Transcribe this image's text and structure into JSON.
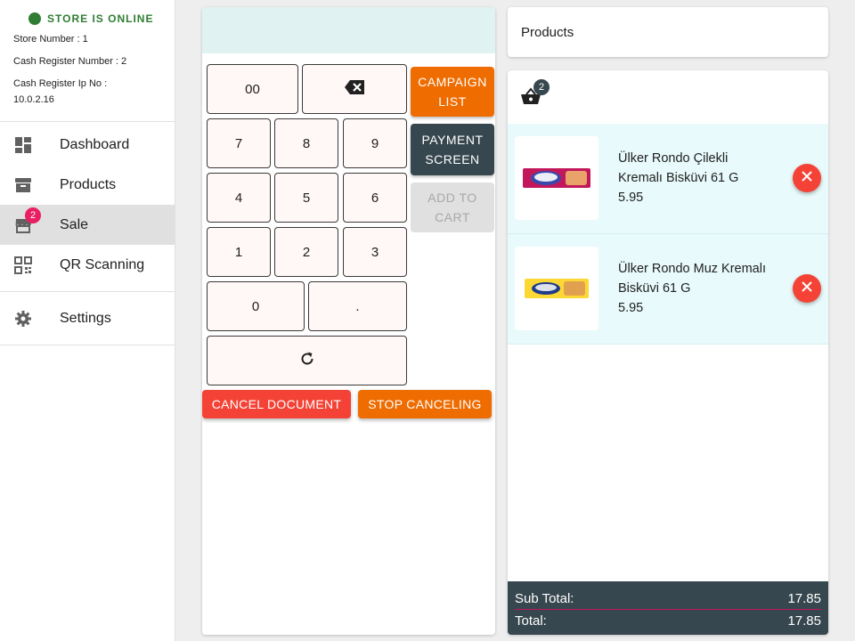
{
  "store": {
    "status": "STORE IS ONLINE",
    "status_color": "#2e7d32",
    "store_number": "Store Number : 1",
    "register_number": "Cash Register Number : 2",
    "register_ip_label": "Cash Register Ip No :",
    "register_ip": "10.0.2.16"
  },
  "sidebar": {
    "items": [
      {
        "label": "Dashboard",
        "icon": "dashboard-icon"
      },
      {
        "label": "Products",
        "icon": "archive-icon"
      },
      {
        "label": "Sale",
        "icon": "store-icon",
        "badge": "2"
      },
      {
        "label": "QR Scanning",
        "icon": "qr-code-icon"
      },
      {
        "label": "Settings",
        "icon": "gear-icon"
      }
    ]
  },
  "keypad": {
    "display": "",
    "keys": {
      "double_zero": "00",
      "seven": "7",
      "eight": "8",
      "nine": "9",
      "four": "4",
      "five": "5",
      "six": "6",
      "one": "1",
      "two": "2",
      "three": "3",
      "zero": "0",
      "dot": "."
    },
    "campaign_list": "CAMPAIGN LIST",
    "payment_screen": "PAYMENT SCREEN",
    "add_to_cart": "ADD TO CART",
    "cancel_document": "CANCEL DOCUMENT",
    "stop_canceling": "STOP CANCELING"
  },
  "products_header": "Products",
  "cart": {
    "count": "2",
    "items": [
      {
        "name": "Ülker Rondo Çilekli Kremalı Bisküvi 61 G",
        "price": "5.95",
        "thumb": "pink-biscuit-pack"
      },
      {
        "name": "Ülker Rondo Muz Kremalı Bisküvi 61 G",
        "price": "5.95",
        "thumb": "yellow-biscuit-pack"
      }
    ],
    "subtotal_label": "Sub Total:",
    "subtotal": "17.85",
    "total_label": "Total:",
    "total": "17.85"
  },
  "colors": {
    "accent_orange": "#ef6c00",
    "accent_dark": "#37474f",
    "danger": "#f44336",
    "badge_pink": "#e91e63"
  }
}
